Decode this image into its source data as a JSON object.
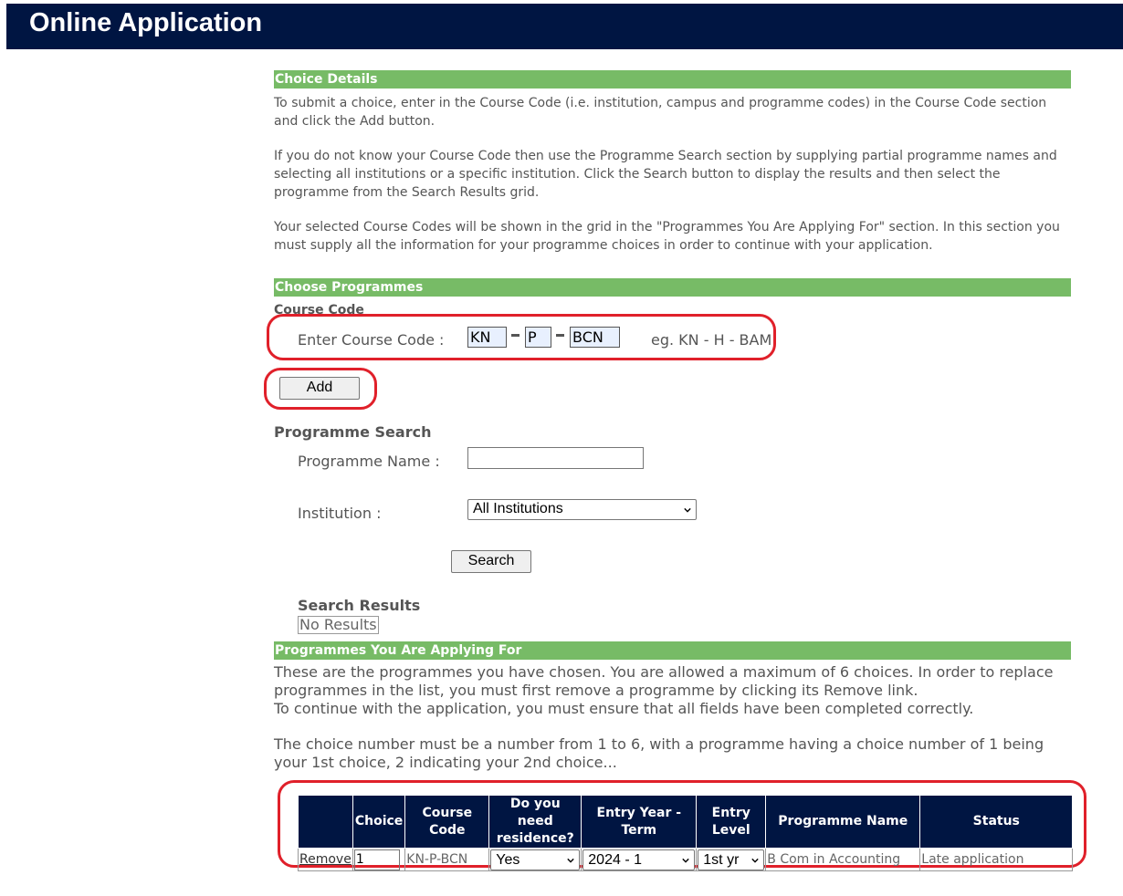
{
  "header": {
    "title": "Online Application"
  },
  "choice_details": {
    "heading": "Choice Details",
    "paragraphs": [
      "To submit a choice, enter in the Course Code (i.e. institution, campus and programme codes) in the Course Code section and click the Add button.",
      "If you do not know your Course Code then use the Programme Search section by supplying partial programme names and selecting all institutions or a specific institution. Click the Search button to display the results and then select the programme from the Search Results grid.",
      "Your selected Course Codes will be shown in the grid in the \"Programmes You Are Applying For\" section. In this section you must supply all the information for your programme choices in order to continue with your application."
    ]
  },
  "choose_programmes": {
    "heading": "Choose Programmes",
    "course_code": {
      "subheading": "Course Code",
      "label": "Enter Course Code :",
      "institution_value": "KN",
      "campus_value": "P",
      "programme_value": "BCN",
      "example": "eg. KN - H - BAM",
      "add_label": "Add"
    },
    "programme_search": {
      "subheading": "Programme Search",
      "name_label": "Programme Name :",
      "name_value": "",
      "institution_label": "Institution :",
      "institution_selected": "All Institutions",
      "search_label": "Search",
      "results_heading": "Search Results",
      "results_empty": "No Results"
    }
  },
  "applying_for": {
    "heading": "Programmes You Are Applying For",
    "paragraphs": [
      "These are the programmes you have chosen. You are allowed a maximum of 6 choices. In order to replace programmes in the list, you must first remove a programme by clicking its Remove link.",
      "To continue with the application, you must ensure that all fields have been completed correctly.",
      "The choice number must be a number from 1 to 6, with a programme having a choice number of 1 being your 1st choice, 2 indicating your 2nd choice..."
    ],
    "table": {
      "headers": [
        "",
        "Choice",
        "Course Code",
        "Do you need residence?",
        "Entry Year - Term",
        "Entry Level",
        "Programme Name",
        "Status"
      ],
      "rows": [
        {
          "remove": "Remove",
          "choice": "1",
          "course_code": "KN-P-BCN",
          "residence": "Yes",
          "entry_year_term": "2024 - 1",
          "entry_level": "1st yr",
          "programme_name": "B Com in Accounting",
          "status": "Late application"
        }
      ]
    }
  },
  "colors": {
    "header_bg": "#001542",
    "section_bar": "#77bb66",
    "highlight": "#e0202a"
  }
}
